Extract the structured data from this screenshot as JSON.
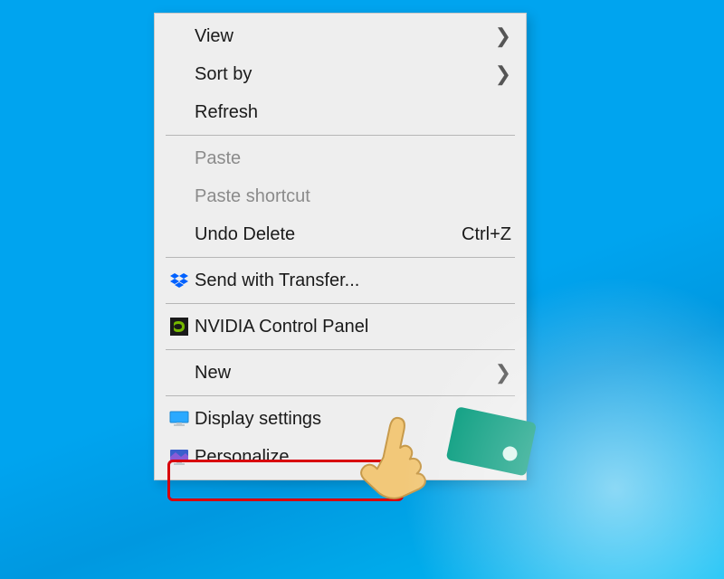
{
  "menu": {
    "items": [
      {
        "label": "View",
        "submenu": true
      },
      {
        "label": "Sort by",
        "submenu": true
      },
      {
        "label": "Refresh"
      },
      {
        "sep": true
      },
      {
        "label": "Paste",
        "disabled": true
      },
      {
        "label": "Paste shortcut",
        "disabled": true
      },
      {
        "label": "Undo Delete",
        "shortcut": "Ctrl+Z"
      },
      {
        "sep": true
      },
      {
        "label": "Send with Transfer...",
        "icon": "dropbox"
      },
      {
        "sep": true
      },
      {
        "label": "NVIDIA Control Panel",
        "icon": "nvidia"
      },
      {
        "sep": true
      },
      {
        "label": "New",
        "submenu": true
      },
      {
        "sep": true
      },
      {
        "label": "Display settings",
        "icon": "display"
      },
      {
        "label": "Personalize",
        "icon": "personalize"
      }
    ]
  },
  "highlight_target": "Display settings"
}
